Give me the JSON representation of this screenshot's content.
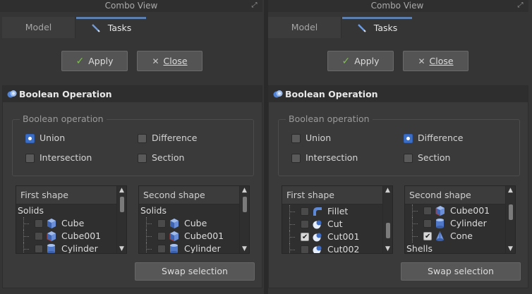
{
  "left": {
    "title": "Combo View",
    "tabs": {
      "model": "Model",
      "tasks": "Tasks"
    },
    "buttons": {
      "apply": "Apply",
      "close": "Close"
    },
    "panel_title": "Boolean Operation",
    "group_title": "Boolean operation",
    "options": {
      "union": "Union",
      "difference": "Difference",
      "intersection": "Intersection",
      "section": "Section"
    },
    "selected_option": "Union",
    "first_shape": {
      "header": "First shape",
      "rows": [
        {
          "label": "Solids",
          "kind": "group"
        },
        {
          "label": "Cube",
          "icon": "cube-icon",
          "checked": false
        },
        {
          "label": "Cube001",
          "icon": "cube-icon",
          "checked": false
        },
        {
          "label": "Cylinder",
          "icon": "cylinder-icon",
          "checked": false
        }
      ]
    },
    "second_shape": {
      "header": "Second shape",
      "rows": [
        {
          "label": "Solids",
          "kind": "group"
        },
        {
          "label": "Cube",
          "icon": "cube-icon",
          "checked": false
        },
        {
          "label": "Cube001",
          "icon": "cube-icon",
          "checked": false
        },
        {
          "label": "Cylinder",
          "icon": "cylinder-icon",
          "checked": false
        }
      ]
    },
    "swap_label": "Swap selection"
  },
  "right": {
    "title": "Combo View",
    "tabs": {
      "model": "Model",
      "tasks": "Tasks"
    },
    "buttons": {
      "apply": "Apply",
      "close": "Close"
    },
    "panel_title": "Boolean Operation",
    "group_title": "Boolean operation",
    "options": {
      "union": "Union",
      "difference": "Difference",
      "intersection": "Intersection",
      "section": "Section"
    },
    "selected_option": "Difference",
    "first_shape": {
      "header": "First shape",
      "rows": [
        {
          "label": "Fillet",
          "icon": "fillet-icon",
          "checked": false
        },
        {
          "label": "Cut",
          "icon": "cut-icon",
          "checked": false
        },
        {
          "label": "Cut001",
          "icon": "cut-icon",
          "checked": true
        },
        {
          "label": "Cut002",
          "icon": "cut-icon",
          "checked": false
        }
      ]
    },
    "second_shape": {
      "header": "Second shape",
      "rows": [
        {
          "label": "Cube001",
          "icon": "cube-icon",
          "checked": false
        },
        {
          "label": "Cylinder",
          "icon": "cylinder-icon",
          "checked": false
        },
        {
          "label": "Cone",
          "icon": "cone-icon",
          "checked": true
        },
        {
          "label": "Shells",
          "kind": "group"
        }
      ]
    },
    "swap_label": "Swap selection"
  },
  "colors": {
    "accent": "#3b6fc7",
    "tab_underline": "#5d7fb0",
    "apply_check": "#7fc04d"
  }
}
